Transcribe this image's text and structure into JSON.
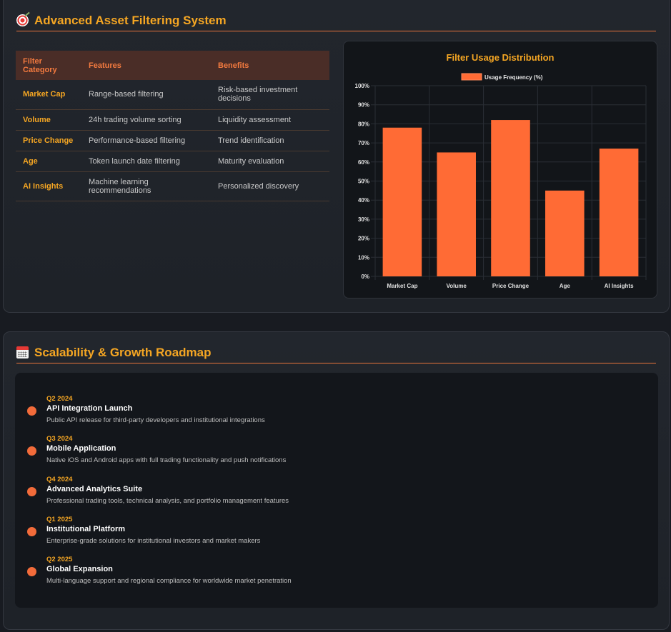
{
  "filter_section": {
    "title": "Advanced Asset Filtering System",
    "icon": "target-icon",
    "table": {
      "headers": [
        "Filter Category",
        "Features",
        "Benefits"
      ],
      "rows": [
        [
          "Market Cap",
          "Range-based filtering",
          "Risk-based investment decisions"
        ],
        [
          "Volume",
          "24h trading volume sorting",
          "Liquidity assessment"
        ],
        [
          "Price Change",
          "Performance-based filtering",
          "Trend identification"
        ],
        [
          "Age",
          "Token launch date filtering",
          "Maturity evaluation"
        ],
        [
          "AI Insights",
          "Machine learning recommendations",
          "Personalized discovery"
        ]
      ]
    }
  },
  "chart_data": {
    "type": "bar",
    "title": "Filter Usage Distribution",
    "categories": [
      "Market Cap",
      "Volume",
      "Price Change",
      "Age",
      "AI Insights"
    ],
    "series": [
      {
        "name": "Usage Frequency (%)",
        "values": [
          78,
          65,
          82,
          45,
          67
        ]
      }
    ],
    "ylim": [
      0,
      100
    ],
    "yticks": [
      "0%",
      "10%",
      "20%",
      "30%",
      "40%",
      "50%",
      "60%",
      "70%",
      "80%",
      "90%",
      "100%"
    ],
    "legend_position": "top",
    "grid": true,
    "bar_color": "#ff6b35"
  },
  "roadmap_section": {
    "title": "Scalability & Growth Roadmap",
    "icon": "calendar-icon",
    "items": [
      {
        "date": "Q2 2024",
        "title": "API Integration Launch",
        "desc": "Public API release for third-party developers and institutional integrations"
      },
      {
        "date": "Q3 2024",
        "title": "Mobile Application",
        "desc": "Native iOS and Android apps with full trading functionality and push notifications"
      },
      {
        "date": "Q4 2024",
        "title": "Advanced Analytics Suite",
        "desc": "Professional trading tools, technical analysis, and portfolio management features"
      },
      {
        "date": "Q1 2025",
        "title": "Institutional Platform",
        "desc": "Enterprise-grade solutions for institutional investors and market makers"
      },
      {
        "date": "Q2 2025",
        "title": "Global Expansion",
        "desc": "Multi-language support and regional compliance for worldwide market penetration"
      }
    ]
  },
  "colors": {
    "accent": "#f5a623",
    "orange": "#f26b3a",
    "background": "#181b21"
  }
}
